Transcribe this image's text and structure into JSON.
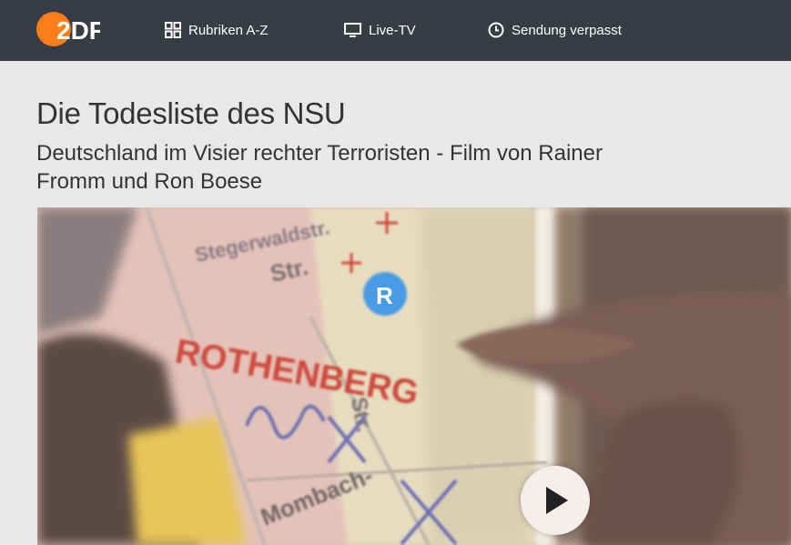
{
  "header": {
    "logo_text": "2DF",
    "nav": [
      {
        "label": "Rubriken A-Z",
        "icon": "grid-icon"
      },
      {
        "label": "Live-TV",
        "icon": "monitor-icon"
      },
      {
        "label": "Sendung verpasst",
        "icon": "clock-icon"
      }
    ]
  },
  "page": {
    "title": "Die Todesliste des NSU",
    "subtitle": "Deutschland im Visier rechter Terroristen - Film von Rainer Fromm und Ron Boese"
  },
  "video": {
    "map_labels": [
      "Stegerwaldstr.",
      "Str.",
      "R",
      "ROTHENBERG",
      "Str.",
      "Mombach-"
    ],
    "play_icon": "play-icon"
  },
  "colors": {
    "header_bg": "#383c43",
    "page_bg": "#e8e8e8",
    "logo_orange": "#fa7d19",
    "text": "#333336"
  }
}
